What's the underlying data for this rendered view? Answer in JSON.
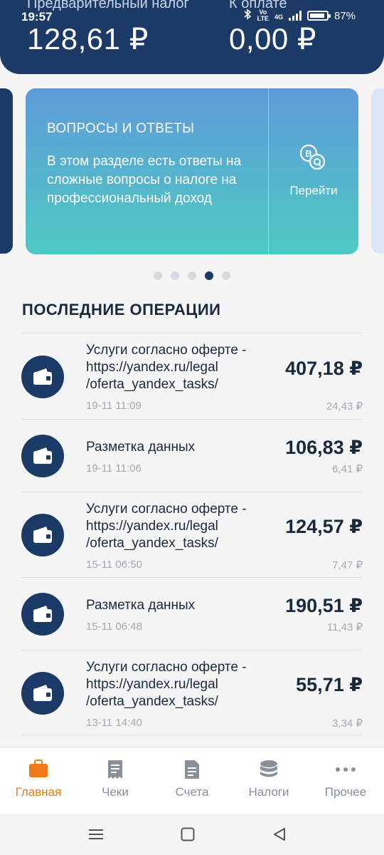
{
  "status_bar": {
    "time": "19:57",
    "network": "4G",
    "battery": "87%"
  },
  "header": {
    "label_left": "Предварительный налог",
    "amount_left": "128,61 ₽",
    "label_right": "К оплате",
    "amount_right": "0,00 ₽"
  },
  "card": {
    "title": "ВОПРОСЫ И ОТВЕТЫ",
    "text": "В этом разделе есть ответы на сложные вопросы о налоге на профессиональный доход",
    "action": "Перейти",
    "icon": "faq-chat-icon"
  },
  "carousel": {
    "total_pages": 5,
    "active_page": 4
  },
  "section_title": "ПОСЛЕДНИЕ ОПЕРАЦИИ",
  "operations": [
    {
      "name": "Услуги согласно оферте - https://yandex.ru/legal /oferta_yandex_tasks/",
      "date": "19-11 11:09",
      "amount": "407,18 ₽",
      "tax": "24,43 ₽"
    },
    {
      "name": "Разметка данных",
      "date": "19-11 11:06",
      "amount": "106,83 ₽",
      "tax": "6,41 ₽"
    },
    {
      "name": "Услуги согласно оферте - https://yandex.ru/legal /oferta_yandex_tasks/",
      "date": "15-11 06:50",
      "amount": "124,57 ₽",
      "tax": "7,47 ₽"
    },
    {
      "name": "Разметка данных",
      "date": "15-11 06:48",
      "amount": "190,51 ₽",
      "tax": "11,43 ₽"
    },
    {
      "name": "Услуги согласно оферте - https://yandex.ru/legal /oferta_yandex_tasks/",
      "date": "13-11 14:40",
      "amount": "55,71 ₽",
      "tax": "3,34 ₽"
    }
  ],
  "nav": {
    "items": [
      {
        "label": "Главная",
        "icon": "briefcase-icon",
        "active": true
      },
      {
        "label": "Чеки",
        "icon": "receipt-icon",
        "active": false
      },
      {
        "label": "Счета",
        "icon": "document-icon",
        "active": false
      },
      {
        "label": "Налоги",
        "icon": "coins-icon",
        "active": false
      },
      {
        "label": "Прочее",
        "icon": "more-icon",
        "active": false
      }
    ]
  },
  "colors": {
    "primary": "#1b3a66",
    "accent": "#f07a1a",
    "card_top": "#5e9bd9",
    "card_bottom": "#4ec9c3",
    "muted": "#a3a9b2"
  }
}
